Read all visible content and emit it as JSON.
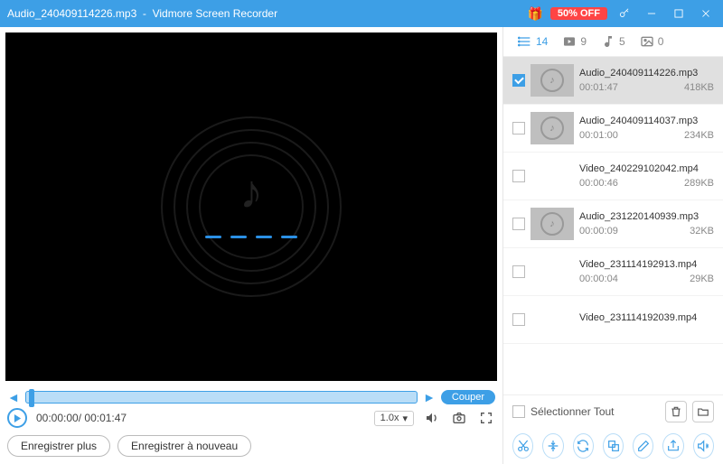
{
  "titlebar": {
    "filename": "Audio_240409114226.mp3",
    "appname": "Vidmore Screen Recorder",
    "promo": "50% OFF"
  },
  "player": {
    "current_time": "00:00:00",
    "total_time": "00:01:47",
    "speed": "1.0x",
    "cut_label": "Couper"
  },
  "buttons": {
    "save_more": "Enregistrer plus",
    "save_again": "Enregistrer à nouveau",
    "select_all": "Sélectionner Tout"
  },
  "tabs": {
    "all_count": "14",
    "video_count": "9",
    "audio_count": "5",
    "image_count": "0"
  },
  "items": [
    {
      "name": "Audio_240409114226.mp3",
      "duration": "00:01:47",
      "size": "418KB",
      "type": "audio",
      "checked": true,
      "selected": true
    },
    {
      "name": "Audio_240409114037.mp3",
      "duration": "00:01:00",
      "size": "234KB",
      "type": "audio",
      "checked": false,
      "selected": false
    },
    {
      "name": "Video_240229102042.mp4",
      "duration": "00:00:46",
      "size": "289KB",
      "type": "video",
      "checked": false,
      "selected": false
    },
    {
      "name": "Audio_231220140939.mp3",
      "duration": "00:00:09",
      "size": "32KB",
      "type": "audio",
      "checked": false,
      "selected": false
    },
    {
      "name": "Video_231114192913.mp4",
      "duration": "00:00:04",
      "size": "29KB",
      "type": "video",
      "checked": false,
      "selected": false
    },
    {
      "name": "Video_231114192039.mp4",
      "duration": "",
      "size": "",
      "type": "video",
      "checked": false,
      "selected": false
    }
  ]
}
